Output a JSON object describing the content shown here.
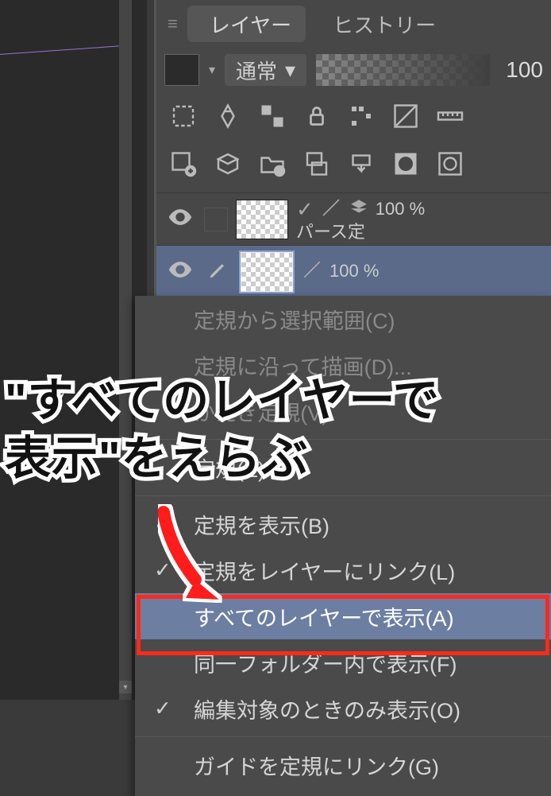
{
  "tabs": {
    "layers_label": "レイヤー",
    "history_label": "ヒストリー"
  },
  "blend": {
    "mode": "通常",
    "opacity": "100"
  },
  "layers": [
    {
      "opacity": "100 %",
      "name": "パース定"
    },
    {
      "opacity": "100 %",
      "name": ""
    }
  ],
  "context_menu": {
    "items": [
      {
        "label": "定規から選択範囲(C)",
        "disabled": true
      },
      {
        "label": "定規に沿って描画(D)...",
        "disabled": true
      },
      {
        "label": "かえき定規(V)",
        "disabled": true,
        "obscured": true
      },
      {
        "sep": true
      },
      {
        "label": "定規(E)",
        "disabled": false,
        "obscured": true
      },
      {
        "sep": true
      },
      {
        "label": "定規を表示(B)",
        "checked": true
      },
      {
        "label": "定規をレイヤーにリンク(L)",
        "checked": true
      },
      {
        "label": "すべてのレイヤーで表示(A)",
        "highlight": true
      },
      {
        "label": "同一フォルダー内で表示(F)"
      },
      {
        "label": "編集対象のときのみ表示(O)",
        "checked": true
      },
      {
        "sep": true
      },
      {
        "label": "ガイドを定規にリンク(G)"
      }
    ]
  },
  "annotation": {
    "text": "\"すべてのレイヤーで\n表示\"をえらぶ"
  },
  "colors": {
    "highlight": "#ff2a1a"
  }
}
